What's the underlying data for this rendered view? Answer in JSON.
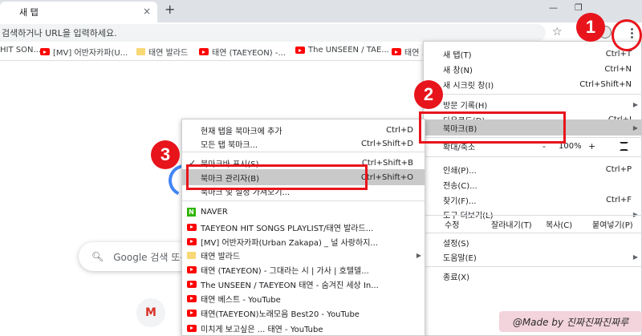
{
  "tab": {
    "title": "새 탭",
    "close": "×",
    "new_tab": "+"
  },
  "window": {
    "minimize": "—",
    "restore": "❐",
    "close": "✕"
  },
  "omnibox": {
    "text": "검색하거나 URL을 입력하세요."
  },
  "bookmarks_bar": [
    {
      "label": "HIT SON...",
      "icon": "youtube"
    },
    {
      "label": "[MV] 어반자카파(U...",
      "icon": "youtube"
    },
    {
      "label": "태연 발라드",
      "icon": "folder"
    },
    {
      "label": "태연 (TAEYEON) -...",
      "icon": "youtube"
    },
    {
      "label": "The UNSEEN / TAE...",
      "icon": "youtube"
    },
    {
      "label": "태연 ...",
      "icon": "youtube"
    }
  ],
  "ntp": {
    "search_placeholder": "Google 검색 또는",
    "gmail_letter": "M"
  },
  "main_menu": {
    "new_tab": {
      "label": "새 탭(T)",
      "shortcut": "Ctrl+T"
    },
    "new_window": {
      "label": "새 창(N)",
      "shortcut": "Ctrl+N"
    },
    "incognito": {
      "label": "새 시크릿 창(I)",
      "shortcut": "Ctrl+Shift+N"
    },
    "history": {
      "label": "방문 기록(H)"
    },
    "downloads": {
      "label": "다운로드(D)",
      "shortcut": "Ctrl+J"
    },
    "bookmarks": {
      "label": "북마크(B)"
    },
    "zoom": {
      "label": "확대/축소",
      "minus": "-",
      "value": "100%",
      "plus": "+"
    },
    "print": {
      "label": "인쇄(P)...",
      "shortcut": "Ctrl+P"
    },
    "cast": {
      "label": "전송(C)..."
    },
    "find": {
      "label": "찾기(F)...",
      "shortcut": "Ctrl+F"
    },
    "more_tools": {
      "label": "도구 더보기(L)"
    },
    "edit": {
      "label": "수정",
      "cut": "잘라내기(T)",
      "copy": "복사(C)",
      "paste": "붙여넣기(P)"
    },
    "settings": {
      "label": "설정(S)"
    },
    "help": {
      "label": "도움말(E)"
    },
    "exit": {
      "label": "종료(X)"
    }
  },
  "bookmark_menu": {
    "add_tab": {
      "label": "현재 탭을 북마크에 추가",
      "shortcut": "Ctrl+D"
    },
    "all_tabs": {
      "label": "모든 탭 북마크...",
      "shortcut": "Ctrl+Shift+D"
    },
    "show_bar": {
      "label": "북마크바 표시(S)",
      "shortcut": "Ctrl+Shift+B",
      "checked": "✓"
    },
    "manager": {
      "label": "북마크 관리자(B)",
      "shortcut": "Ctrl+Shift+O"
    },
    "import": {
      "label": "북마크 및 설정 가져오기..."
    },
    "items": [
      {
        "label": "NAVER",
        "icon": "naver"
      },
      {
        "label": "TAEYEON HIT SONGS PLAYLIST/태연 발라드...",
        "icon": "youtube"
      },
      {
        "label": "[MV] 어반자카파(Urban Zakapa) _ 널 사랑하지...",
        "icon": "youtube"
      },
      {
        "label": "태연 발라드",
        "icon": "folder"
      },
      {
        "label": "태연 (TAEYEON) - 그대라는 시 | 가사 | 호텔델...",
        "icon": "youtube"
      },
      {
        "label": "The UNSEEN / TAEYEON 태연 - 숨겨진 세상 In...",
        "icon": "youtube"
      },
      {
        "label": "태연 베스트 - YouTube",
        "icon": "youtube"
      },
      {
        "label": "태연(TAEYEON)노래모음 Best20 - YouTube",
        "icon": "youtube"
      },
      {
        "label": "미치게 보고싶은 ... 태연 - YouTube",
        "icon": "youtube"
      }
    ]
  },
  "annotations": [
    "1",
    "2",
    "3"
  ],
  "watermark": "@Made by 진짜진짜진짜루",
  "colors": {
    "annotation_red": "#e8141b",
    "highlight": "#c9c9c9",
    "watermark_bg": "#f3d3dc"
  }
}
